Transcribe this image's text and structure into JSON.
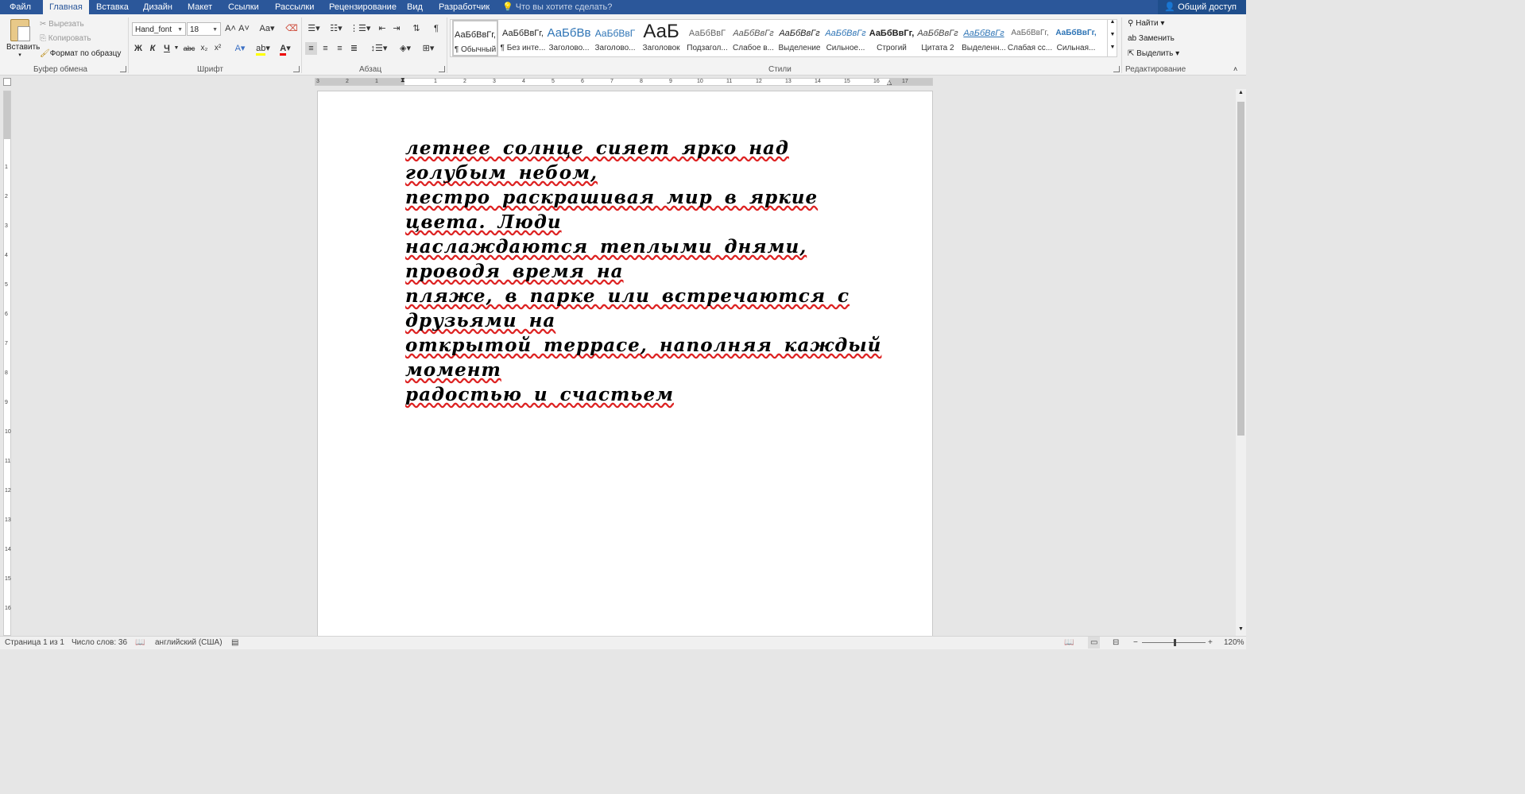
{
  "tabs": [
    "Файл",
    "Главная",
    "Вставка",
    "Дизайн",
    "Макет",
    "Ссылки",
    "Рассылки",
    "Рецензирование",
    "Вид",
    "Разработчик"
  ],
  "active_tab": "Главная",
  "tell_me": "Что вы хотите сделать?",
  "share": "Общий доступ",
  "clipboard": {
    "paste": "Вставить",
    "cut": "Вырезать",
    "copy": "Копировать",
    "format_painter": "Формат по образцу",
    "label": "Буфер обмена"
  },
  "font": {
    "name": "Hand_font",
    "size": "18",
    "label": "Шрифт",
    "bold": "Ж",
    "italic": "К",
    "underline": "Ч",
    "strike": "abc",
    "sub": "x₂",
    "sup": "x²",
    "case": "Aa"
  },
  "paragraph": {
    "label": "Абзац"
  },
  "styles": {
    "label": "Стили",
    "items": [
      {
        "preview": "АаБбВвГг,",
        "name": "¶ Обычный"
      },
      {
        "preview": "АаБбВвГг,",
        "name": "¶ Без инте..."
      },
      {
        "preview": "АаБбВв",
        "name": "Заголово..."
      },
      {
        "preview": "АаБбВвГ",
        "name": "Заголово..."
      },
      {
        "preview": "АаБ",
        "name": "Заголовок"
      },
      {
        "preview": "АаБбВвГ",
        "name": "Подзагол..."
      },
      {
        "preview": "АаБбВвГг",
        "name": "Слабое в..."
      },
      {
        "preview": "АаБбВвГг",
        "name": "Выделение"
      },
      {
        "preview": "АаБбВвГг",
        "name": "Сильное..."
      },
      {
        "preview": "АаБбВвГг,",
        "name": "Строгий"
      },
      {
        "preview": "АаБбВвГг",
        "name": "Цитата 2"
      },
      {
        "preview": "АаБбВвГг",
        "name": "Выделенн..."
      },
      {
        "preview": "АаБбВвГг,",
        "name": "Слабая сс..."
      },
      {
        "preview": "АаБбВвГг,",
        "name": "Сильная..."
      }
    ]
  },
  "editing": {
    "find": "Найти",
    "replace": "Заменить",
    "select": "Выделить",
    "label": "Редактирование"
  },
  "ruler_h": [
    "3",
    "2",
    "1",
    "1",
    "2",
    "3",
    "4",
    "5",
    "6",
    "7",
    "8",
    "9",
    "10",
    "11",
    "12",
    "13",
    "14",
    "15",
    "16",
    "17"
  ],
  "ruler_v": [
    "1",
    "2",
    "3",
    "4",
    "5",
    "6",
    "7",
    "8",
    "9",
    "10",
    "11",
    "12",
    "13",
    "14",
    "15",
    "16"
  ],
  "document": {
    "lines": [
      "летнее солнце сияет ярко над голубым небом,",
      "пестро раскрашивая мир в яркие цвета. Люди",
      "наслаждаются теплыми днями, проводя время на",
      "пляже, в парке или встречаются с друзьями на",
      "открытой террасе, наполняя каждый момент",
      "радостью и счастьем"
    ]
  },
  "status": {
    "page": "Страница 1 из 1",
    "words": "Число слов: 36",
    "language": "английский (США)",
    "zoom": "120%"
  }
}
